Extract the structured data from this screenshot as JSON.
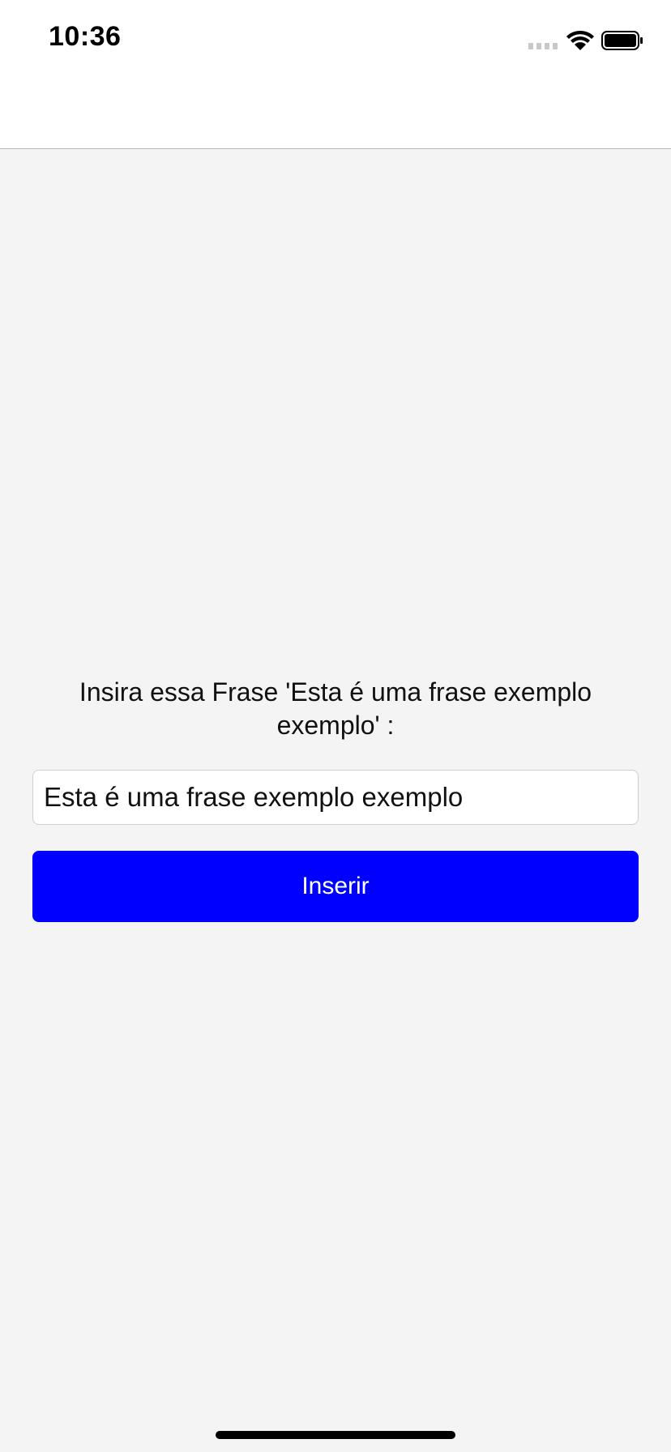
{
  "status_bar": {
    "time": "10:36",
    "icons": [
      "cellular-signal-icon",
      "wifi-icon",
      "battery-icon"
    ]
  },
  "main": {
    "prompt": "Insira essa Frase 'Esta é uma frase exemplo exemplo' :",
    "input_value": "Esta é uma frase exemplo exemplo",
    "button_label": "Inserir"
  },
  "colors": {
    "background": "#f4f4f4",
    "header_background": "#ffffff",
    "button_background": "#0000ff",
    "button_text": "#ffffff"
  }
}
